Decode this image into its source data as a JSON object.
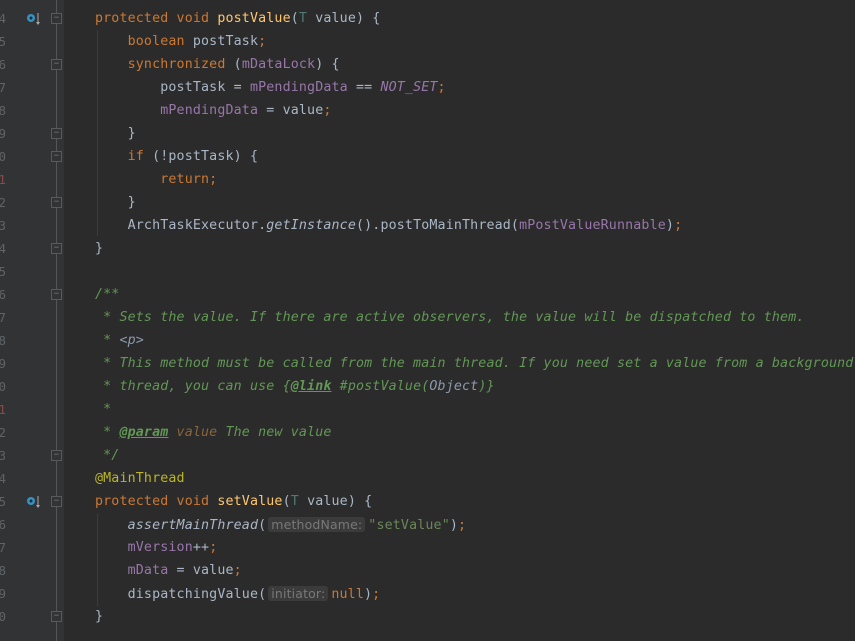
{
  "gutter": {
    "line_numbers": [
      "4",
      "5",
      "6",
      "7",
      "8",
      "9",
      "0",
      "1",
      "2",
      "3",
      "4",
      "5",
      "6",
      "7",
      "8",
      "9",
      "0",
      "1",
      "2",
      "3",
      "4",
      "5",
      "6",
      "7",
      "8",
      "9",
      "0"
    ],
    "error_lines": [
      7,
      17
    ],
    "override_icon_rows": [
      0,
      21
    ],
    "fold_rows": [
      0,
      2,
      5,
      6,
      8,
      10,
      12,
      19,
      21,
      26
    ],
    "icons": {
      "override": "overriding-method-icon",
      "fold": "fold-marker-icon"
    }
  },
  "code": {
    "lines": [
      [
        [
          "protected void ",
          "kw"
        ],
        [
          "postValue",
          "fn"
        ],
        [
          "(",
          "txt"
        ],
        [
          "T ",
          "tp"
        ],
        [
          "value) {",
          "txt"
        ]
      ],
      [
        [
          "    boolean ",
          "kw"
        ],
        [
          "postTask",
          "txt"
        ],
        [
          ";",
          "kw"
        ]
      ],
      [
        [
          "    synchronized ",
          "kw"
        ],
        [
          "(",
          "txt"
        ],
        [
          "mDataLock",
          "fld"
        ],
        [
          ") {",
          "txt"
        ]
      ],
      [
        [
          "        postTask = ",
          "txt"
        ],
        [
          "mPendingData",
          "fld"
        ],
        [
          " == ",
          "txt"
        ],
        [
          "NOT_SET",
          "fldi"
        ],
        [
          ";",
          "kw"
        ]
      ],
      [
        [
          "        ",
          "txt"
        ],
        [
          "mPendingData",
          "fld"
        ],
        [
          " = value",
          "txt"
        ],
        [
          ";",
          "kw"
        ]
      ],
      [
        [
          "    }",
          "txt"
        ]
      ],
      [
        [
          "    if ",
          "kw"
        ],
        [
          "(!postTask) {",
          "txt"
        ]
      ],
      [
        [
          "        return;",
          "kw"
        ]
      ],
      [
        [
          "    }",
          "txt"
        ]
      ],
      [
        [
          "    ArchTaskExecutor.",
          "txt"
        ],
        [
          "getInstance",
          "sti"
        ],
        [
          "().postToMainThread(",
          "txt"
        ],
        [
          "mPostValueRunnable",
          "fld"
        ],
        [
          ")",
          "txt"
        ],
        [
          ";",
          "kw"
        ]
      ],
      [
        [
          "}",
          "txt"
        ]
      ],
      [],
      [
        [
          "/**",
          "cm"
        ]
      ],
      [
        [
          " * Sets the value. If there are active observers, the value will be dispatched to them.",
          "cm"
        ]
      ],
      [
        [
          " * ",
          "cm"
        ],
        [
          "<p>",
          "cmref"
        ]
      ],
      [
        [
          " * This method must be called from the main thread. If you need set a value from a background",
          "cm"
        ]
      ],
      [
        [
          " * thread, you can use {",
          "cm"
        ],
        [
          "@link",
          "cmtag"
        ],
        [
          " #postValue(",
          "cm"
        ],
        [
          "Object",
          "cmref"
        ],
        [
          ")}",
          "cm"
        ]
      ],
      [
        [
          " *",
          "cm"
        ]
      ],
      [
        [
          " * ",
          "cm"
        ],
        [
          "@param",
          "cmtag"
        ],
        [
          " value",
          "cmpar"
        ],
        [
          " The new value",
          "cm"
        ]
      ],
      [
        [
          " */",
          "cm"
        ]
      ],
      [
        [
          "@MainThread",
          "ann"
        ]
      ],
      [
        [
          "protected void ",
          "kw"
        ],
        [
          "setValue",
          "fn"
        ],
        [
          "(",
          "txt"
        ],
        [
          "T ",
          "tp"
        ],
        [
          "value) {",
          "txt"
        ]
      ],
      [
        [
          "    ",
          "txt"
        ],
        [
          "assertMainThread",
          "sti"
        ],
        [
          "(",
          "txt"
        ],
        [
          "methodName:",
          "hint"
        ],
        [
          "\"setValue\"",
          "str"
        ],
        [
          ")",
          "txt"
        ],
        [
          ";",
          "kw"
        ]
      ],
      [
        [
          "    ",
          "txt"
        ],
        [
          "mVersion",
          "fld"
        ],
        [
          "++",
          "txt"
        ],
        [
          ";",
          "kw"
        ]
      ],
      [
        [
          "    ",
          "txt"
        ],
        [
          "mData",
          "fld"
        ],
        [
          " = value",
          "txt"
        ],
        [
          ";",
          "kw"
        ]
      ],
      [
        [
          "    dispatchingValue(",
          "txt"
        ],
        [
          "initiator:",
          "hint"
        ],
        [
          "null",
          "kw"
        ],
        [
          ")",
          "txt"
        ],
        [
          ";",
          "kw"
        ]
      ],
      [
        [
          "}",
          "txt"
        ]
      ]
    ]
  }
}
